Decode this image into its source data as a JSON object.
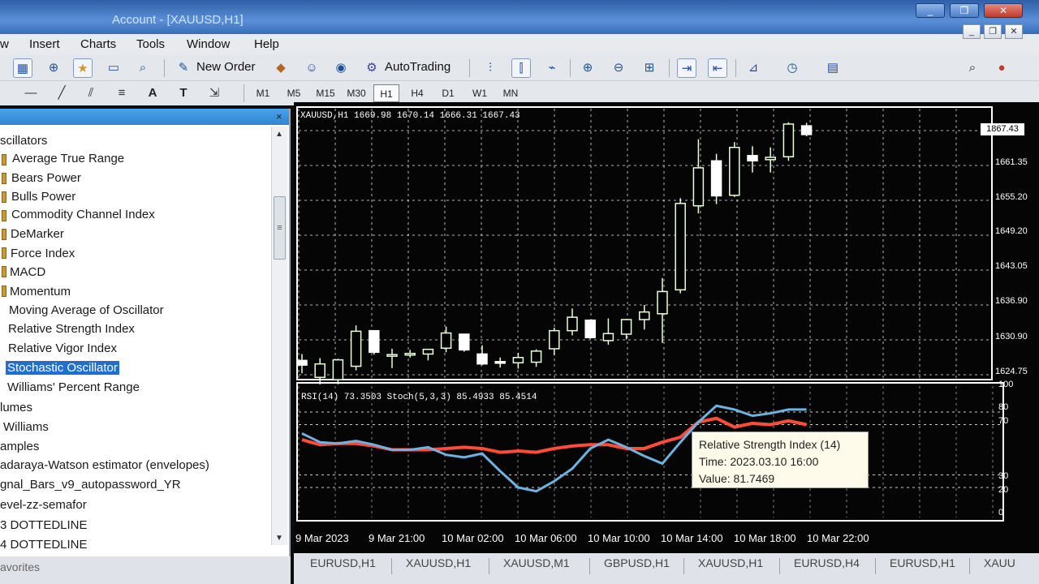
{
  "window": {
    "title": "Account - [XAUUSD,H1]",
    "buttons": [
      "_",
      "❐",
      "✕"
    ]
  },
  "menu": [
    "w",
    "Insert",
    "Charts",
    "Tools",
    "Window",
    "Help"
  ],
  "toolbar": {
    "new_order": "New Order",
    "auto_trading": "AutoTrading"
  },
  "drawing_tools": [
    "A",
    "T"
  ],
  "timeframes": {
    "items": [
      "M1",
      "M5",
      "M15",
      "M30",
      "H1",
      "H4",
      "D1",
      "W1",
      "MN"
    ],
    "active": "H1"
  },
  "navigator": {
    "close": "×",
    "section": "scillators",
    "items": [
      "Average True Range",
      "Bears Power",
      "Bulls Power",
      "Commodity Channel Index",
      "DeMarker",
      "Force Index",
      "MACD",
      "Momentum",
      "Moving Average of Oscillator",
      "Relative Strength Index",
      "Relative Vigor Index",
      "Stochastic Oscillator",
      "Williams' Percent Range"
    ],
    "selected": "Stochastic Oscillator",
    "sections_after": [
      "lumes",
      "Williams",
      "amples"
    ],
    "custom": [
      "adaraya-Watson estimator (envelopes)",
      "gnal_Bars_v9_autopassword_YR",
      "evel-zz-semafor",
      "3 DOTTEDLINE",
      "4 DOTTEDLINE"
    ],
    "favorites_tab": "avorites"
  },
  "chart": {
    "symbol_line": "XAUUSD,H1  1669.98 1670.14 1666.31 1667.43",
    "indicator_line": "RSI(14) 73.3503  Stoch(5,3,3) 85.4933 85.4514",
    "price_ticks": [
      "1661.35",
      "1655.20",
      "1649.20",
      "1643.05",
      "1636.90",
      "1630.90",
      "1624.75"
    ],
    "current_price": "1867.43",
    "osc_ticks": [
      "100",
      "80",
      "70",
      "30",
      "20",
      "0"
    ],
    "time_ticks": [
      "9 Mar 2023",
      "9 Mar 21:00",
      "10 Mar 02:00",
      "10 Mar 06:00",
      "10 Mar 10:00",
      "10 Mar 14:00",
      "10 Mar 18:00",
      "10 Mar 22:00"
    ],
    "tooltip": {
      "title": "Relative Strength Index (14)",
      "time": "Time: 2023.03.10 16:00",
      "value": "Value: 81.7469"
    },
    "colors": {
      "bull": "#ffffff",
      "bear": "#ffffff",
      "rsi": "#6fb2e0",
      "stoch": "#ff4b3a",
      "grid": "#ffffff"
    }
  },
  "chart_data": {
    "type": "line",
    "candles": [
      {
        "o": 1627.2,
        "h": 1628.3,
        "l": 1625.0,
        "c": 1626.4
      },
      {
        "o": 1624.3,
        "h": 1627.6,
        "l": 1623.1,
        "c": 1626.6
      },
      {
        "o": 1623.9,
        "h": 1627.5,
        "l": 1623.1,
        "c": 1627.3
      },
      {
        "o": 1626.2,
        "h": 1633.2,
        "l": 1625.5,
        "c": 1632.2
      },
      {
        "o": 1632.3,
        "h": 1632.3,
        "l": 1628.2,
        "c": 1628.6
      },
      {
        "o": 1628.0,
        "h": 1629.2,
        "l": 1625.9,
        "c": 1628.2
      },
      {
        "o": 1628.2,
        "h": 1629.0,
        "l": 1627.7,
        "c": 1628.4
      },
      {
        "o": 1628.3,
        "h": 1629.2,
        "l": 1627.2,
        "c": 1629.1
      },
      {
        "o": 1629.3,
        "h": 1633.0,
        "l": 1628.6,
        "c": 1631.9
      },
      {
        "o": 1631.7,
        "h": 1631.7,
        "l": 1628.7,
        "c": 1629.0
      },
      {
        "o": 1628.3,
        "h": 1629.8,
        "l": 1626.4,
        "c": 1626.6
      },
      {
        "o": 1627.0,
        "h": 1627.7,
        "l": 1626.0,
        "c": 1626.9
      },
      {
        "o": 1626.8,
        "h": 1628.5,
        "l": 1625.8,
        "c": 1627.7
      },
      {
        "o": 1626.9,
        "h": 1629.1,
        "l": 1626.1,
        "c": 1628.8
      },
      {
        "o": 1629.2,
        "h": 1632.8,
        "l": 1628.1,
        "c": 1632.3
      },
      {
        "o": 1632.3,
        "h": 1636.1,
        "l": 1631.5,
        "c": 1634.6
      },
      {
        "o": 1634.1,
        "h": 1634.1,
        "l": 1630.9,
        "c": 1631.1
      },
      {
        "o": 1630.6,
        "h": 1634.4,
        "l": 1629.9,
        "c": 1631.8
      },
      {
        "o": 1631.7,
        "h": 1634.3,
        "l": 1630.8,
        "c": 1634.2
      },
      {
        "o": 1634.2,
        "h": 1636.7,
        "l": 1632.5,
        "c": 1635.5
      },
      {
        "o": 1635.2,
        "h": 1641.3,
        "l": 1630.2,
        "c": 1639.0
      },
      {
        "o": 1639.3,
        "h": 1655.0,
        "l": 1638.7,
        "c": 1654.1
      },
      {
        "o": 1653.7,
        "h": 1665.1,
        "l": 1652.4,
        "c": 1660.2
      },
      {
        "o": 1661.4,
        "h": 1662.6,
        "l": 1654.0,
        "c": 1655.4
      },
      {
        "o": 1655.5,
        "h": 1664.6,
        "l": 1655.2,
        "c": 1663.7
      },
      {
        "o": 1662.3,
        "h": 1663.9,
        "l": 1659.4,
        "c": 1661.4
      },
      {
        "o": 1661.6,
        "h": 1663.7,
        "l": 1659.4,
        "c": 1662.0
      },
      {
        "o": 1662.1,
        "h": 1668.0,
        "l": 1661.4,
        "c": 1667.7
      },
      {
        "o": 1667.4,
        "h": 1667.9,
        "l": 1665.6,
        "c": 1665.9
      }
    ],
    "rsi": [
      63,
      56,
      55,
      57,
      54,
      50,
      50,
      52,
      46,
      44,
      47,
      33,
      20,
      17,
      25,
      35,
      51,
      58,
      52,
      45,
      39,
      56,
      72,
      85,
      82,
      77,
      79,
      82,
      82
    ],
    "stoch_main": [
      58,
      54,
      55,
      55,
      53,
      50,
      50,
      50,
      51,
      52,
      51,
      48,
      49,
      48,
      51,
      53,
      54,
      54,
      51,
      51,
      56,
      60,
      72,
      75,
      68,
      71,
      70,
      73,
      70
    ],
    "osc_range": [
      0,
      100
    ],
    "price_range": [
      1624.75,
      1669.5
    ]
  },
  "chart_tabs": [
    "EURUSD,H1",
    "XAUUSD,H1",
    "XAUUSD,M1",
    "GBPUSD,H1",
    "XAUUSD,H1",
    "EURUSD,H4",
    "EURUSD,H1",
    "XAUU"
  ]
}
